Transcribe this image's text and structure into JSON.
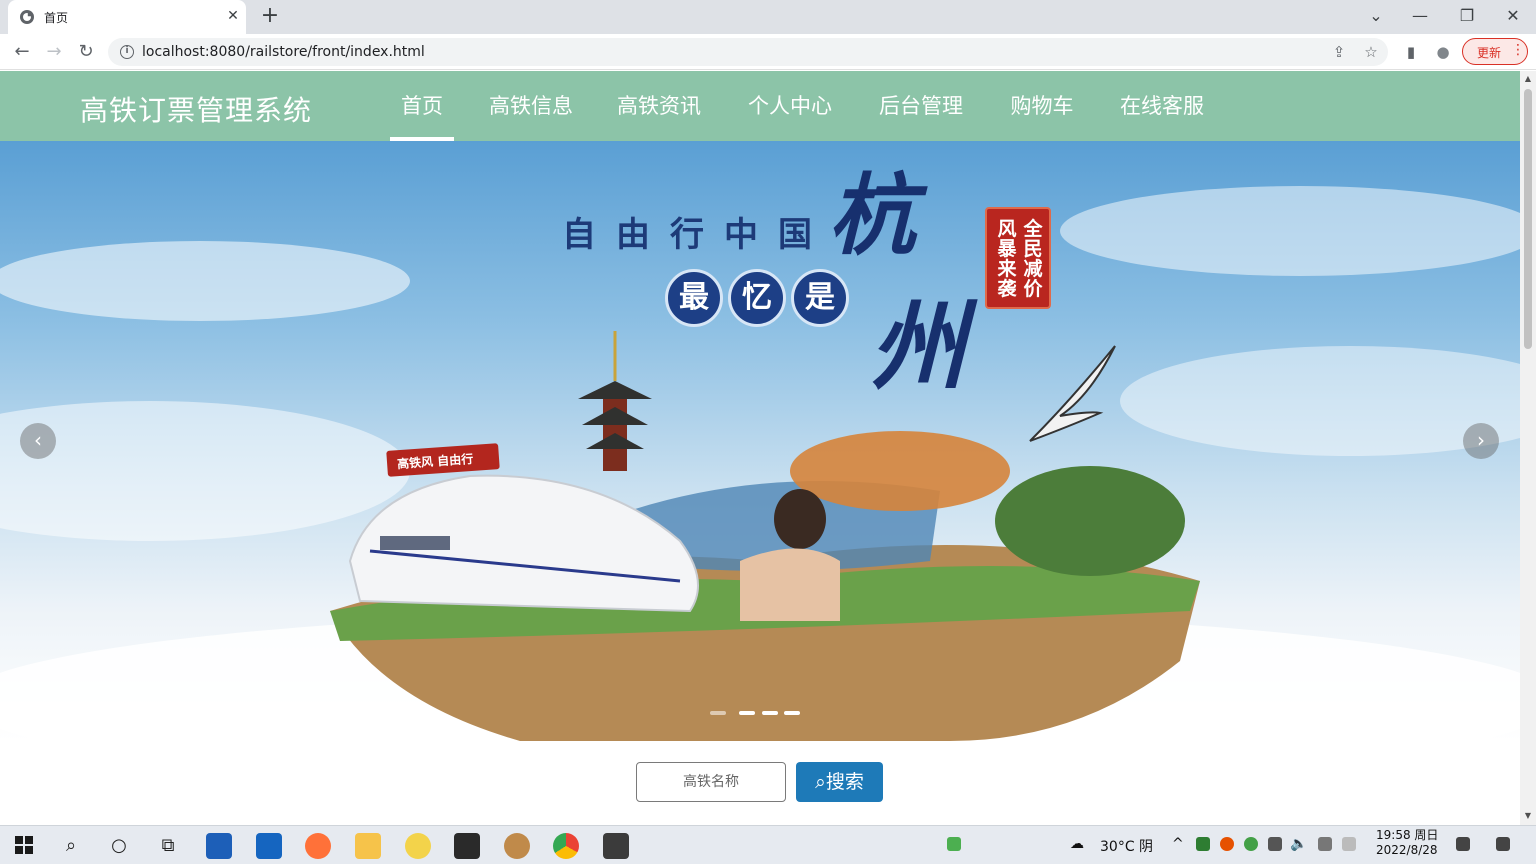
{
  "browser": {
    "tab_title": "首页",
    "tab_close": "✕",
    "new_tab": "+",
    "url": "localhost:8080/railstore/front/index.html",
    "update_label": "更新",
    "update_menu": "⋮",
    "window_controls": {
      "dropdown": "⌄",
      "minimize": "—",
      "restore": "❐",
      "close": "✕"
    },
    "nav": {
      "back": "←",
      "forward": "→",
      "reload": "↻"
    },
    "icons": {
      "share": "⇪",
      "bookmark": "☆",
      "sidepanel": "▮",
      "profile": "●"
    }
  },
  "site": {
    "title": "高铁订票管理系统",
    "nav_items": [
      {
        "label": "首页",
        "active": true
      },
      {
        "label": "高铁信息",
        "active": false
      },
      {
        "label": "高铁资讯",
        "active": false
      },
      {
        "label": "个人中心",
        "active": false
      },
      {
        "label": "后台管理",
        "active": false
      },
      {
        "label": "购物车",
        "active": false
      },
      {
        "label": "在线客服",
        "active": false
      }
    ],
    "header_color": "#8cc4a8"
  },
  "banner": {
    "slogan": "自由行中国",
    "circle_chars": [
      "最",
      "忆",
      "是"
    ],
    "big_chars": [
      "杭",
      "州"
    ],
    "seal_col1": "全民减价",
    "seal_col2": "风暴来袭",
    "ribbon": "高铁风 自由行",
    "prev": "‹",
    "next": "›",
    "slide_count": 4,
    "active_slide": 1
  },
  "search": {
    "placeholder": "高铁名称",
    "button_label": "搜索",
    "button_icon": "⌕",
    "button_color": "#1e7ab8"
  },
  "taskbar": {
    "weather": "30°C 阴",
    "time": "19:58 周日",
    "date": "2022/8/28",
    "chevron": "^"
  }
}
